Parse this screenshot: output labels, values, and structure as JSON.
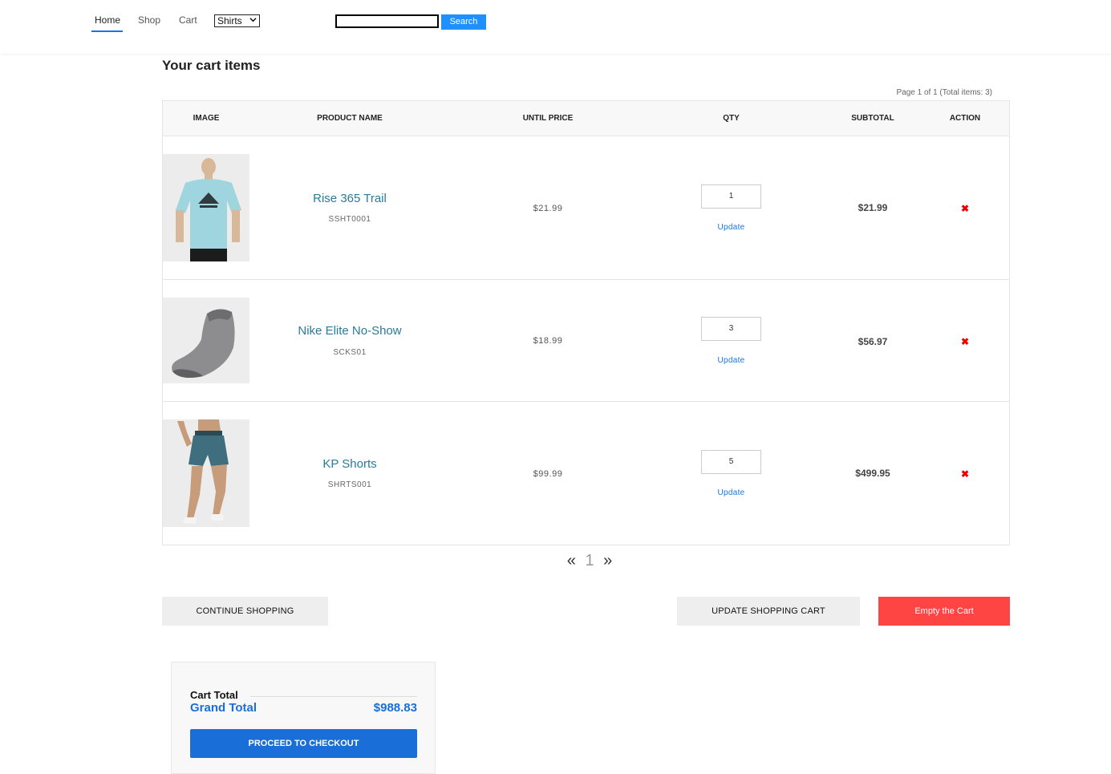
{
  "nav": {
    "home": "Home",
    "shop": "Shop",
    "cart": "Cart",
    "category_selected": "Shirts",
    "search_value": "",
    "search_button": "Search"
  },
  "page": {
    "title": "Your cart items",
    "page_info": "Page 1 of 1 (Total items: 3)"
  },
  "table": {
    "headers": [
      "IMAGE",
      "PRODUCT NAME",
      "UNTIL PRICE",
      "QTY",
      "SUBTOTAL",
      "ACTION"
    ],
    "rows": [
      {
        "name": "Rise 365 Trail",
        "sku": "SSHT0001",
        "unit_price": "$21.99",
        "qty": "1",
        "update": "Update",
        "subtotal": "$21.99",
        "remove": "✖",
        "image": "light-blue-tshirt-photo"
      },
      {
        "name": "Nike Elite No-Show",
        "sku": "SCKS01",
        "unit_price": "$18.99",
        "qty": "3",
        "update": "Update",
        "subtotal": "$56.97",
        "remove": "✖",
        "image": "grey-sock-photo"
      },
      {
        "name": "KP Shorts",
        "sku": "SHRTS001",
        "unit_price": "$99.99",
        "qty": "5",
        "update": "Update",
        "subtotal": "$499.95",
        "remove": "✖",
        "image": "teal-shorts-photo"
      }
    ]
  },
  "pagination": {
    "prev": "«",
    "current": "1",
    "next": "»"
  },
  "actions": {
    "continue": "CONTINUE SHOPPING",
    "update_cart": "UPDATE SHOPPING CART",
    "empty": "Empty the Cart"
  },
  "totals": {
    "cart_total_label": "Cart Total",
    "grand_total_label": "Grand Total",
    "grand_total_value": "$988.83",
    "checkout_button": "PROCEED TO CHECKOUT"
  },
  "colors": {
    "accent_blue": "#1a6ed8",
    "link_teal": "#2b7a9b",
    "danger_red": "#ff4444"
  }
}
